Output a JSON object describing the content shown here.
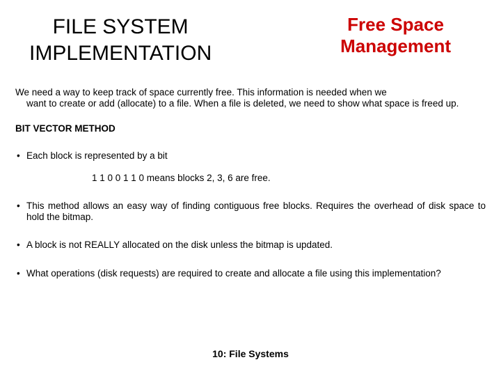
{
  "header": {
    "title_left_line1": "FILE SYSTEM",
    "title_left_line2": "IMPLEMENTATION",
    "title_right_line1": "Free Space",
    "title_right_line2": "Management"
  },
  "intro": {
    "line1": "We need a way to keep track of space currently free. This information is needed when we",
    "line_rest": "want to create or add (allocate) to a file. When a file is deleted, we need to show what space is freed up."
  },
  "subhead": "BIT VECTOR METHOD",
  "bullets": {
    "b1": "Each block is represented by a bit",
    "example": "1 1 0 0 1 1 0 means blocks 2, 3, 6 are free.",
    "b2": "This method allows an easy way of finding contiguous free blocks. Requires the overhead of disk space to hold the bitmap.",
    "b3": "A block is not REALLY allocated on the disk unless the bitmap is updated.",
    "b4": "What operations (disk requests) are required to create and allocate a file using this implementation?"
  },
  "footer": "10: File Systems"
}
